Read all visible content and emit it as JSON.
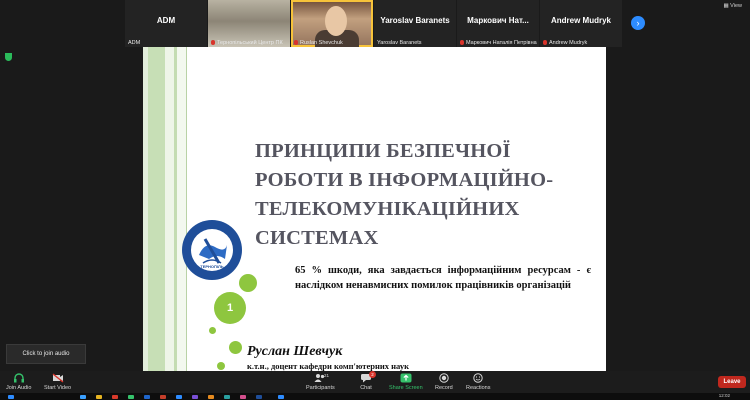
{
  "participants": [
    {
      "big": "ADM",
      "tag": "ADM",
      "muted": false
    },
    {
      "big": "",
      "tag": "Тернопільський Центр ПК",
      "muted": true
    },
    {
      "big": "",
      "tag": "Ruslan Shevchuk",
      "muted": true
    },
    {
      "big": "Yaroslav Baranets",
      "tag": "Yaroslav Baranets",
      "muted": false
    },
    {
      "big": "Маркович Нат...",
      "tag": "Маркович Наталія Петрівна",
      "muted": true
    },
    {
      "big": "Andrew Mudryk",
      "tag": "Andrew Mudryk",
      "muted": true
    }
  ],
  "view_label": "View",
  "next_icon": "chevron-right-icon",
  "slide": {
    "title": "Принципи безпечної роботи в інформаційно-телекомунікаційних системах",
    "description": "65 % шкоди, яка завдається інформаційним ресурсам - є наслідком ненавмисних помилок працівників організацій",
    "author": "Руслан Шевчук",
    "position": "к.т.н., доцент кафедри комп'ютерних наук",
    "page_number": "1",
    "logo_text": "ТЕРНОПІЛЬСЬКИЙ НАЦІОНАЛЬНИЙ ЕКОНОМІЧНИЙ УНІВЕРСИТЕТ",
    "logo_city": "ТЕРНОПІЛЬ",
    "accent_color": "#8ec63f"
  },
  "click_to_join_audio": "Click to join audio",
  "toolbar": {
    "join_audio": "Join Audio",
    "start_video": "Start Video",
    "participants": "Participants",
    "participants_count": "21",
    "chat": "Chat",
    "chat_badge": "2",
    "share_screen": "Share Screen",
    "record": "Record",
    "reactions": "Reactions",
    "leave": "Leave"
  },
  "clock": "12:02",
  "colors": {
    "leave": "#c0281e",
    "share": "#35c26b",
    "active_speaker": "#f7c33a",
    "link": "#2d8cff"
  }
}
